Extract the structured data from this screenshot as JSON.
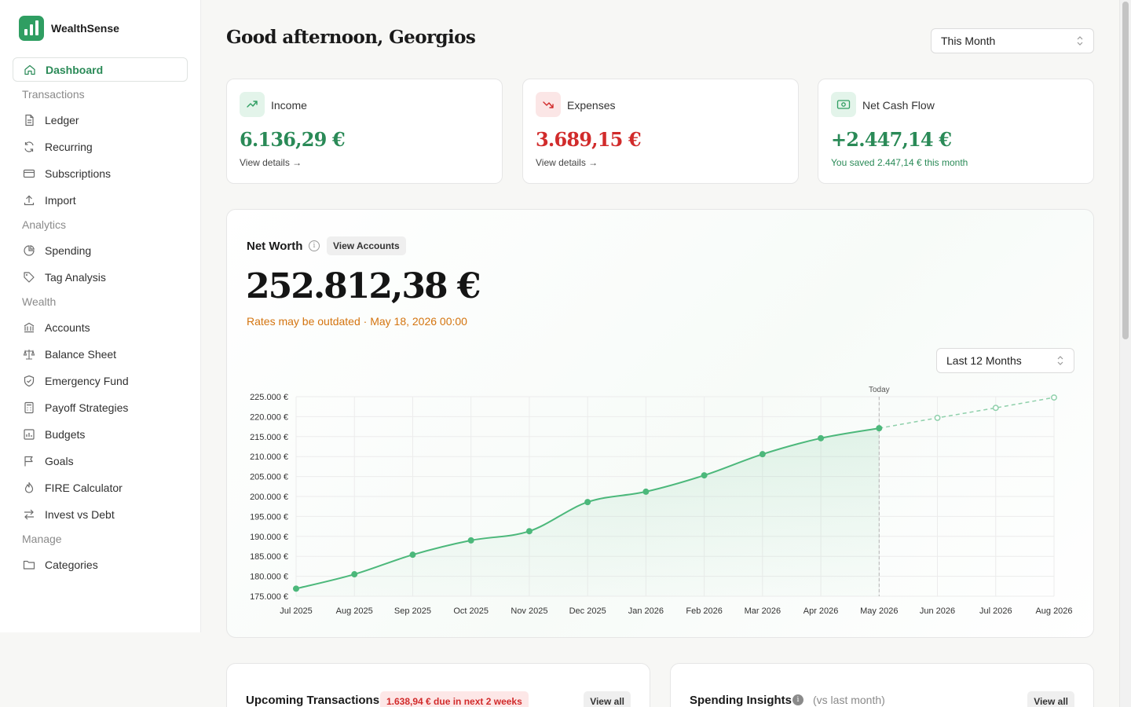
{
  "brand": {
    "name": "WealthSense"
  },
  "sidebar": {
    "items": [
      {
        "type": "item",
        "label": "Dashboard",
        "icon": "home-icon",
        "active": true
      },
      {
        "type": "section",
        "label": "Transactions"
      },
      {
        "type": "item",
        "label": "Ledger",
        "icon": "document-icon"
      },
      {
        "type": "item",
        "label": "Recurring",
        "icon": "refresh-icon"
      },
      {
        "type": "item",
        "label": "Subscriptions",
        "icon": "credit-card-icon"
      },
      {
        "type": "item",
        "label": "Import",
        "icon": "upload-icon"
      },
      {
        "type": "section",
        "label": "Analytics"
      },
      {
        "type": "item",
        "label": "Spending",
        "icon": "pie-chart-icon"
      },
      {
        "type": "item",
        "label": "Tag Analysis",
        "icon": "tag-icon"
      },
      {
        "type": "section",
        "label": "Wealth"
      },
      {
        "type": "item",
        "label": "Accounts",
        "icon": "bank-icon"
      },
      {
        "type": "item",
        "label": "Balance Sheet",
        "icon": "scale-icon"
      },
      {
        "type": "item",
        "label": "Emergency Fund",
        "icon": "shield-icon"
      },
      {
        "type": "item",
        "label": "Payoff Strategies",
        "icon": "calculator-icon"
      },
      {
        "type": "item",
        "label": "Budgets",
        "icon": "budget-chart-icon"
      },
      {
        "type": "item",
        "label": "Goals",
        "icon": "flag-icon"
      },
      {
        "type": "item",
        "label": "FIRE Calculator",
        "icon": "flame-icon"
      },
      {
        "type": "item",
        "label": "Invest vs Debt",
        "icon": "swap-arrows-icon"
      },
      {
        "type": "section",
        "label": "Manage"
      },
      {
        "type": "item",
        "label": "Categories",
        "icon": "folder-icon"
      }
    ]
  },
  "header": {
    "greeting": "Good afternoon, Georgios",
    "period_select": "This Month"
  },
  "stats": {
    "income": {
      "title": "Income",
      "value": "6.136,29 €",
      "link": "View details",
      "color": "#2a8a57",
      "icon": "trending-up-icon"
    },
    "expenses": {
      "title": "Expenses",
      "value": "3.689,15 €",
      "link": "View details",
      "color": "#d12b2b",
      "icon": "trending-down-icon"
    },
    "net": {
      "title": "Net Cash Flow",
      "value": "+2.447,14 €",
      "note": "You saved 2.447,14 € this month",
      "color": "#2a8a57",
      "icon": "cash-icon"
    }
  },
  "net_worth": {
    "title": "Net Worth",
    "view_accounts": "View Accounts",
    "value": "252.812,38 €",
    "rates_note": "Rates may be outdated · May 18, 2026 00:00",
    "range_select": "Last 12 Months",
    "today_label": "Today"
  },
  "chart_data": {
    "type": "line",
    "x": [
      "Jul 2025",
      "Aug 2025",
      "Sep 2025",
      "Oct 2025",
      "Nov 2025",
      "Dec 2025",
      "Jan 2026",
      "Feb 2026",
      "Mar 2026",
      "Apr 2026",
      "May 2026",
      "Jun 2026",
      "Jul 2026",
      "Aug 2026"
    ],
    "values": [
      176900,
      180500,
      185400,
      189000,
      191300,
      198600,
      201200,
      205300,
      210600,
      214600,
      217100,
      219700,
      222200,
      224800
    ],
    "projected_from_index": 10,
    "ylim": [
      175000,
      225000
    ],
    "yticks": [
      225000,
      220000,
      215000,
      210000,
      205000,
      200000,
      195000,
      190000,
      185000,
      180000,
      175000
    ],
    "ytick_labels": [
      "225.000 €",
      "220.000 €",
      "215.000 €",
      "210.000 €",
      "205.000 €",
      "200.000 €",
      "195.000 €",
      "190.000 €",
      "185.000 €",
      "180.000 €",
      "175.000 €"
    ],
    "today_index": 10,
    "grid": true,
    "line_color": "#4cb87b"
  },
  "upcoming": {
    "title": "Upcoming Transactions",
    "badge": "1.638,94 € due in next 2 weeks",
    "view_all": "View all"
  },
  "insights": {
    "title": "Spending Insights",
    "subtitle": "(vs last month)",
    "view_all": "View all"
  }
}
